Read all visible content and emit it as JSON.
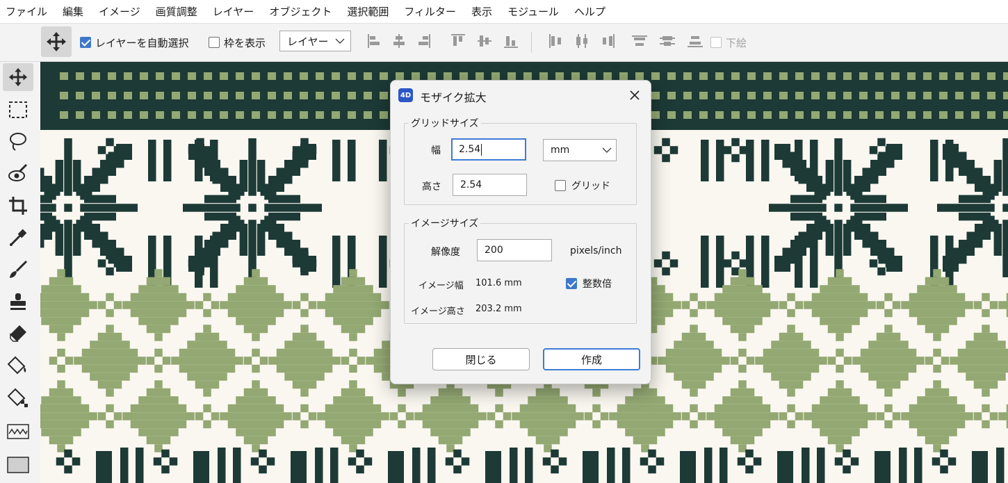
{
  "menu": [
    "ファイル",
    "編集",
    "イメージ",
    "画質調整",
    "レイヤー",
    "オブジェクト",
    "選択範囲",
    "フィルター",
    "表示",
    "モジュール",
    "ヘルプ"
  ],
  "options": {
    "auto_select_label": "レイヤーを自動選択",
    "auto_select_checked": true,
    "show_bounds_label": "枠を表示",
    "show_bounds_checked": false,
    "layer_select_value": "レイヤー",
    "underlay_label": "下絵",
    "underlay_checked": false
  },
  "tools": [
    "move-tool",
    "marquee-tool",
    "lasso-tool",
    "magic-eye-tool",
    "crop-tool",
    "eyedropper-tool",
    "brush-tool",
    "stamp-tool",
    "eraser-tool",
    "fill-tool",
    "pattern-fill-tool",
    "wave-tool",
    "rectangle-tool"
  ],
  "dialog": {
    "app_icon": "4D",
    "title": "モザイク拡大",
    "grid_group_title": "グリッドサイズ",
    "width_label": "幅",
    "width_value": "2.54",
    "height_label": "高さ",
    "height_value": "2.54",
    "unit_value": "mm",
    "grid_checkbox_label": "グリッド",
    "grid_checked": false,
    "image_group_title": "イメージサイズ",
    "resolution_label": "解像度",
    "resolution_value": "200",
    "resolution_unit": "pixels/inch",
    "image_width_label": "イメージ幅",
    "image_width_value": "101.6 mm",
    "integer_label": "整数倍",
    "integer_checked": true,
    "image_height_label": "イメージ高さ",
    "image_height_value": "203.2 mm",
    "close_button": "閉じる",
    "create_button": "作成"
  },
  "colors": {
    "pattern_dark": "#1d3a36",
    "pattern_green": "#93a872",
    "pattern_bg": "#faf7f0",
    "accent": "#3d7bd7"
  }
}
